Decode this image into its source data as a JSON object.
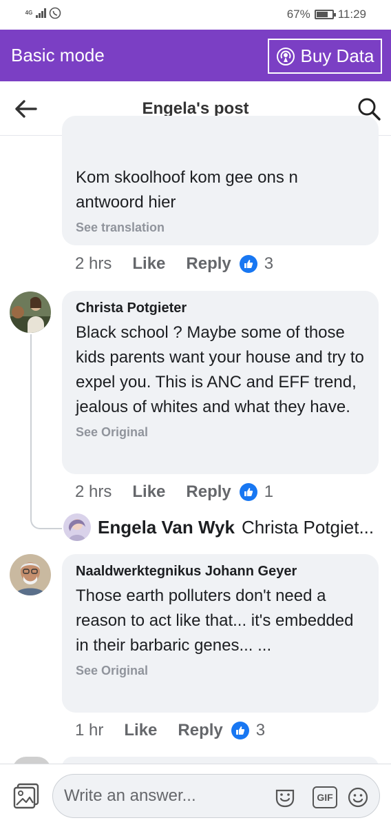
{
  "status_bar": {
    "network": "4G",
    "battery": "67%",
    "time": "11:29"
  },
  "top_bar": {
    "mode": "Basic mode",
    "buy_data": "Buy Data"
  },
  "header": {
    "title": "Engela's post"
  },
  "comments": [
    {
      "text": "Kom skoolhoof kom gee ons n antwoord hier",
      "translation": "See translation",
      "time": "2 hrs",
      "like": "Like",
      "reply": "Reply",
      "likes": "3"
    },
    {
      "author": "Christa Potgieter",
      "text": "Black school ? Maybe some of those kids parents want your house and try to expel you. This is ANC and EFF trend, jealous of whites and what they have.",
      "translation": "See Original",
      "time": "2 hrs",
      "like": "Like",
      "reply": "Reply",
      "likes": "1",
      "reply_preview": {
        "author": "Engela Van Wyk",
        "text": "Christa Potgiet..."
      }
    },
    {
      "author": "Naaldwerktegnikus Johann Geyer",
      "text": "Those earth polluters don't need a reason to act like that... it's embedded in their barbaric genes... ...",
      "translation": "See Original",
      "time": "1 hr",
      "like": "Like",
      "reply": "Reply",
      "likes": "3"
    }
  ],
  "composer": {
    "placeholder": "Write an answer...",
    "gif": "GIF"
  },
  "colors": {
    "brand_purple": "#7b3fc4",
    "like_blue": "#1877f2",
    "bubble_bg": "#f0f2f5"
  }
}
